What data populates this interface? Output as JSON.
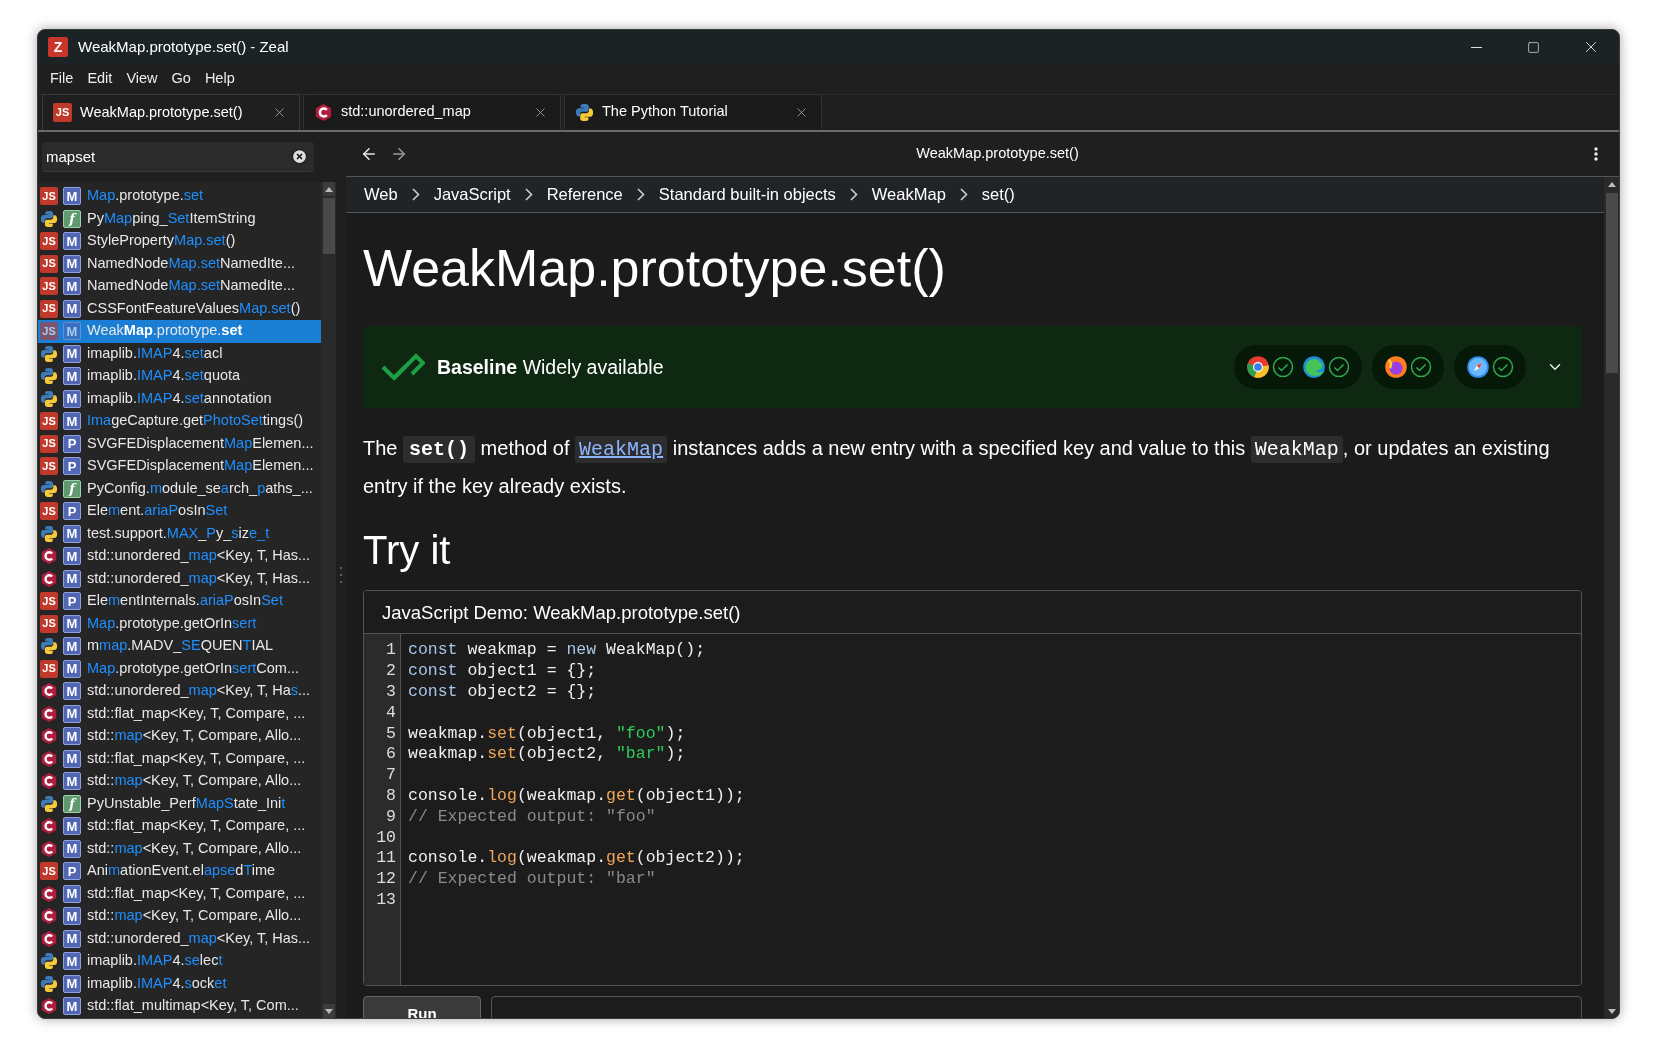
{
  "window": {
    "title": "WeakMap.prototype.set() - Zeal",
    "icon_letter": "Z"
  },
  "menu": [
    "File",
    "Edit",
    "View",
    "Go",
    "Help"
  ],
  "tabs": [
    {
      "kind": "js",
      "badge": "JS",
      "label": "WeakMap.prototype.set()",
      "selected": true
    },
    {
      "kind": "cpp",
      "label": "std::unordered_map",
      "selected": false
    },
    {
      "kind": "python",
      "label": "The Python Tutorial",
      "selected": false
    }
  ],
  "search": {
    "value": "mapset"
  },
  "results": [
    {
      "kind": "js",
      "badge": "JS",
      "type": "M",
      "selected": false,
      "parts": [
        {
          "text": "Map",
          "match": true
        },
        {
          "text": ".prototype.",
          "match": false
        },
        {
          "text": "set",
          "match": true
        }
      ]
    },
    {
      "kind": "python",
      "type": "f",
      "selected": false,
      "parts": [
        {
          "text": "Py",
          "match": false
        },
        {
          "text": "Map",
          "match": true
        },
        {
          "text": "ping_",
          "match": false
        },
        {
          "text": "Set",
          "match": true
        },
        {
          "text": "ItemString",
          "match": false
        }
      ]
    },
    {
      "kind": "js",
      "badge": "JS",
      "type": "M",
      "selected": false,
      "parts": [
        {
          "text": "StyleProperty",
          "match": false
        },
        {
          "text": "Map.set",
          "match": true
        },
        {
          "text": "()",
          "match": false
        }
      ]
    },
    {
      "kind": "js",
      "badge": "JS",
      "type": "M",
      "selected": false,
      "parts": [
        {
          "text": "NamedNode",
          "match": false
        },
        {
          "text": "Map.set",
          "match": true
        },
        {
          "text": "NamedIte...",
          "match": false
        }
      ]
    },
    {
      "kind": "js",
      "badge": "JS",
      "type": "M",
      "selected": false,
      "parts": [
        {
          "text": "NamedNode",
          "match": false
        },
        {
          "text": "Map.set",
          "match": true
        },
        {
          "text": "NamedIte...",
          "match": false
        }
      ]
    },
    {
      "kind": "js",
      "badge": "JS",
      "type": "M",
      "selected": false,
      "parts": [
        {
          "text": "CSSFontFeatureValues",
          "match": false
        },
        {
          "text": "Map.set",
          "match": true
        },
        {
          "text": "()",
          "match": false
        }
      ]
    },
    {
      "kind": "js",
      "badge": "JS",
      "type": "M",
      "selected": true,
      "parts": [
        {
          "text": "Weak",
          "match": false
        },
        {
          "text": "Map",
          "match": true
        },
        {
          "text": ".prototype.",
          "match": false
        },
        {
          "text": "set",
          "match": true
        }
      ]
    },
    {
      "kind": "python",
      "type": "M",
      "selected": false,
      "parts": [
        {
          "text": "imaplib.",
          "match": false
        },
        {
          "text": "IMAP",
          "match": true
        },
        {
          "text": "4.",
          "match": false
        },
        {
          "text": "set",
          "match": true
        },
        {
          "text": "acl",
          "match": false
        }
      ]
    },
    {
      "kind": "python",
      "type": "M",
      "selected": false,
      "parts": [
        {
          "text": "imaplib.",
          "match": false
        },
        {
          "text": "IMAP",
          "match": true
        },
        {
          "text": "4.",
          "match": false
        },
        {
          "text": "set",
          "match": true
        },
        {
          "text": "quota",
          "match": false
        }
      ]
    },
    {
      "kind": "python",
      "type": "M",
      "selected": false,
      "parts": [
        {
          "text": "imaplib.",
          "match": false
        },
        {
          "text": "IMAP",
          "match": true
        },
        {
          "text": "4.",
          "match": false
        },
        {
          "text": "set",
          "match": true
        },
        {
          "text": "annotation",
          "match": false
        }
      ]
    },
    {
      "kind": "js",
      "badge": "JS",
      "type": "M",
      "selected": false,
      "parts": [
        {
          "text": "Ima",
          "match": true
        },
        {
          "text": "geCapture.get",
          "match": false
        },
        {
          "text": "PhotoSet",
          "match": true
        },
        {
          "text": "tings()",
          "match": false
        }
      ]
    },
    {
      "kind": "js",
      "badge": "JS",
      "type": "P",
      "selected": false,
      "parts": [
        {
          "text": "SVGFEDisplacement",
          "match": false
        },
        {
          "text": "Map",
          "match": true
        },
        {
          "text": "Elemen...",
          "match": false
        }
      ]
    },
    {
      "kind": "js",
      "badge": "JS",
      "type": "P",
      "selected": false,
      "parts": [
        {
          "text": "SVGFEDisplacement",
          "match": false
        },
        {
          "text": "Map",
          "match": true
        },
        {
          "text": "Elemen...",
          "match": false
        }
      ]
    },
    {
      "kind": "python",
      "type": "f",
      "selected": false,
      "parts": [
        {
          "text": "PyConfig.",
          "match": false
        },
        {
          "text": "m",
          "match": true
        },
        {
          "text": "odule_se",
          "match": false
        },
        {
          "text": "a",
          "match": true
        },
        {
          "text": "rch_",
          "match": false
        },
        {
          "text": "p",
          "match": true
        },
        {
          "text": "aths_...",
          "match": false
        }
      ]
    },
    {
      "kind": "js",
      "badge": "JS",
      "type": "P",
      "selected": false,
      "parts": [
        {
          "text": "Ele",
          "match": false
        },
        {
          "text": "m",
          "match": true
        },
        {
          "text": "ent.",
          "match": false
        },
        {
          "text": "ariaP",
          "match": true
        },
        {
          "text": "osIn",
          "match": false
        },
        {
          "text": "Set",
          "match": true
        }
      ]
    },
    {
      "kind": "python",
      "type": "M",
      "selected": false,
      "parts": [
        {
          "text": "test.support.",
          "match": false
        },
        {
          "text": "MAX",
          "match": true
        },
        {
          "text": "_",
          "match": false
        },
        {
          "text": "P",
          "match": true
        },
        {
          "text": "y_",
          "match": false
        },
        {
          "text": "s",
          "match": true
        },
        {
          "text": "iz",
          "match": false
        },
        {
          "text": "e_t",
          "match": true
        }
      ]
    },
    {
      "kind": "cpp",
      "type": "M",
      "selected": false,
      "parts": [
        {
          "text": "std::unordered_",
          "match": false
        },
        {
          "text": "map",
          "match": true
        },
        {
          "text": "<Key, T, Has...",
          "match": false
        }
      ]
    },
    {
      "kind": "cpp",
      "type": "M",
      "selected": false,
      "parts": [
        {
          "text": "std::unordered_",
          "match": false
        },
        {
          "text": "map",
          "match": true
        },
        {
          "text": "<Key, T, Has...",
          "match": false
        }
      ]
    },
    {
      "kind": "js",
      "badge": "JS",
      "type": "P",
      "selected": false,
      "parts": [
        {
          "text": "Ele",
          "match": false
        },
        {
          "text": "m",
          "match": true
        },
        {
          "text": "entInternals.",
          "match": false
        },
        {
          "text": "ariaP",
          "match": true
        },
        {
          "text": "osIn",
          "match": false
        },
        {
          "text": "Set",
          "match": true
        }
      ]
    },
    {
      "kind": "js",
      "badge": "JS",
      "type": "M",
      "selected": false,
      "parts": [
        {
          "text": "Map",
          "match": true
        },
        {
          "text": ".prototype.getOrIn",
          "match": false
        },
        {
          "text": "sert",
          "match": true
        }
      ]
    },
    {
      "kind": "python",
      "type": "M",
      "selected": false,
      "parts": [
        {
          "text": "m",
          "match": false
        },
        {
          "text": "map",
          "match": true
        },
        {
          "text": ".MADV_",
          "match": false
        },
        {
          "text": "SE",
          "match": true
        },
        {
          "text": "QUEN",
          "match": false
        },
        {
          "text": "T",
          "match": true
        },
        {
          "text": "IAL",
          "match": false
        }
      ]
    },
    {
      "kind": "js",
      "badge": "JS",
      "type": "M",
      "selected": false,
      "parts": [
        {
          "text": "Map",
          "match": true
        },
        {
          "text": ".prototype.getOrIn",
          "match": false
        },
        {
          "text": "sert",
          "match": true
        },
        {
          "text": "Com...",
          "match": false
        }
      ]
    },
    {
      "kind": "cpp",
      "type": "M",
      "selected": false,
      "parts": [
        {
          "text": "std::unordered_",
          "match": false
        },
        {
          "text": "map",
          "match": true
        },
        {
          "text": "<Key, T, Ha",
          "match": false
        },
        {
          "text": "s",
          "match": true
        },
        {
          "text": "...",
          "match": false
        }
      ]
    },
    {
      "kind": "cpp",
      "type": "M",
      "selected": false,
      "parts": [
        {
          "text": "std::flat_map<Key, T, Compare, ...",
          "match": false
        }
      ]
    },
    {
      "kind": "cpp",
      "type": "M",
      "selected": false,
      "parts": [
        {
          "text": "std::",
          "match": false
        },
        {
          "text": "map",
          "match": true
        },
        {
          "text": "<Key, T, Compare, Allo...",
          "match": false
        }
      ]
    },
    {
      "kind": "cpp",
      "type": "M",
      "selected": false,
      "parts": [
        {
          "text": "std::flat_map<Key, T, Compare, ...",
          "match": false
        }
      ]
    },
    {
      "kind": "cpp",
      "type": "M",
      "selected": false,
      "parts": [
        {
          "text": "std::",
          "match": false
        },
        {
          "text": "map",
          "match": true
        },
        {
          "text": "<Key, T, Compare, Allo...",
          "match": false
        }
      ]
    },
    {
      "kind": "python",
      "type": "f",
      "selected": false,
      "parts": [
        {
          "text": "PyUnstable_Perf",
          "match": false
        },
        {
          "text": "MapS",
          "match": true
        },
        {
          "text": "tate_Ini",
          "match": false
        },
        {
          "text": "t",
          "match": true
        }
      ]
    },
    {
      "kind": "cpp",
      "type": "M",
      "selected": false,
      "parts": [
        {
          "text": "std::flat_map<Key, T, Compare, ...",
          "match": false
        }
      ]
    },
    {
      "kind": "cpp",
      "type": "M",
      "selected": false,
      "parts": [
        {
          "text": "std::",
          "match": false
        },
        {
          "text": "map",
          "match": true
        },
        {
          "text": "<Key, T, Compare, Allo...",
          "match": false
        }
      ]
    },
    {
      "kind": "js",
      "badge": "JS",
      "type": "P",
      "selected": false,
      "parts": [
        {
          "text": "Ani",
          "match": false
        },
        {
          "text": "m",
          "match": true
        },
        {
          "text": "ationEvent.el",
          "match": false
        },
        {
          "text": "apse",
          "match": true
        },
        {
          "text": "d",
          "match": false
        },
        {
          "text": "T",
          "match": true
        },
        {
          "text": "ime",
          "match": false
        }
      ]
    },
    {
      "kind": "cpp",
      "type": "M",
      "selected": false,
      "parts": [
        {
          "text": "std::flat_map<Key, T, Compare, ...",
          "match": false
        }
      ]
    },
    {
      "kind": "cpp",
      "type": "M",
      "selected": false,
      "parts": [
        {
          "text": "std::",
          "match": false
        },
        {
          "text": "map",
          "match": true
        },
        {
          "text": "<Key, T, Compare, Allo...",
          "match": false
        }
      ]
    },
    {
      "kind": "cpp",
      "type": "M",
      "selected": false,
      "parts": [
        {
          "text": "std::unordered_",
          "match": false
        },
        {
          "text": "map",
          "match": true
        },
        {
          "text": "<Key, T, Has...",
          "match": false
        }
      ]
    },
    {
      "kind": "python",
      "type": "M",
      "selected": false,
      "parts": [
        {
          "text": "imaplib.",
          "match": false
        },
        {
          "text": "IMAP",
          "match": true
        },
        {
          "text": "4.",
          "match": false
        },
        {
          "text": "se",
          "match": true
        },
        {
          "text": "lec",
          "match": false
        },
        {
          "text": "t",
          "match": true
        }
      ]
    },
    {
      "kind": "python",
      "type": "M",
      "selected": false,
      "parts": [
        {
          "text": "imaplib.",
          "match": false
        },
        {
          "text": "IMAP",
          "match": true
        },
        {
          "text": "4.",
          "match": false
        },
        {
          "text": "s",
          "match": true
        },
        {
          "text": "ock",
          "match": false
        },
        {
          "text": "et",
          "match": true
        }
      ]
    },
    {
      "kind": "cpp",
      "type": "M",
      "selected": false,
      "parts": [
        {
          "text": "std::flat_multimap<Key, T, Com...",
          "match": false
        }
      ]
    }
  ],
  "page_title": "WeakMap.prototype.set()",
  "breadcrumbs": [
    "Web",
    "JavaScript",
    "Reference",
    "Standard built-in objects",
    "WeakMap",
    "set()"
  ],
  "heading": "WeakMap.prototype.set()",
  "baseline": {
    "label": "**Baseline** Widely available",
    "browser_groups": [
      [
        {
          "kind": "chrome"
        },
        {
          "kind": "edge"
        }
      ],
      [
        {
          "kind": "firefox"
        }
      ],
      [
        {
          "kind": "safari"
        }
      ]
    ]
  },
  "intro": [
    {
      "kind": "text",
      "t": "The "
    },
    {
      "kind": "code_bold",
      "t": "set()"
    },
    {
      "kind": "text",
      "t": " method of "
    },
    {
      "kind": "link",
      "t": "WeakMap"
    },
    {
      "kind": "text",
      "t": " instances adds a new entry with a specified key and value to this "
    },
    {
      "kind": "code",
      "t": "WeakMap"
    },
    {
      "kind": "text",
      "t": ", or updates an existing entry if the key already exists."
    }
  ],
  "try_it": {
    "heading": "Try it",
    "demo_title": "JavaScript Demo: WeakMap.prototype.set()",
    "lines": [
      {
        "number": "1",
        "tokens": [
          {
            "kind": "kw",
            "text": "const"
          },
          {
            "kind": "plain",
            "text": " weakmap = "
          },
          {
            "kind": "kw",
            "text": "new"
          },
          {
            "kind": "plain",
            "text": " WeakMap();"
          }
        ]
      },
      {
        "number": "2",
        "tokens": [
          {
            "kind": "kw",
            "text": "const"
          },
          {
            "kind": "plain",
            "text": " object1 = {};"
          }
        ]
      },
      {
        "number": "3",
        "tokens": [
          {
            "kind": "kw",
            "text": "const"
          },
          {
            "kind": "plain",
            "text": " object2 = {};"
          }
        ]
      },
      {
        "number": "4"
      },
      {
        "number": "5",
        "tokens": [
          {
            "kind": "plain",
            "text": "weakmap."
          },
          {
            "kind": "fn",
            "text": "set"
          },
          {
            "kind": "plain",
            "text": "(object1, "
          },
          {
            "kind": "str",
            "text": "\"foo\""
          },
          {
            "kind": "plain",
            "text": ");"
          }
        ]
      },
      {
        "number": "6",
        "tokens": [
          {
            "kind": "plain",
            "text": "weakmap."
          },
          {
            "kind": "fn",
            "text": "set"
          },
          {
            "kind": "plain",
            "text": "(object2, "
          },
          {
            "kind": "str",
            "text": "\"bar\""
          },
          {
            "kind": "plain",
            "text": ");"
          }
        ]
      },
      {
        "number": "7"
      },
      {
        "number": "8",
        "tokens": [
          {
            "kind": "plain",
            "text": "console."
          },
          {
            "kind": "fn",
            "text": "log"
          },
          {
            "kind": "plain",
            "text": "(weakmap."
          },
          {
            "kind": "fn",
            "text": "get"
          },
          {
            "kind": "plain",
            "text": "(object1));"
          }
        ]
      },
      {
        "number": "9",
        "tokens": [
          {
            "kind": "cmt",
            "text": "// Expected output: \"foo\""
          }
        ]
      },
      {
        "number": "10"
      },
      {
        "number": "11",
        "tokens": [
          {
            "kind": "plain",
            "text": "console."
          },
          {
            "kind": "fn",
            "text": "log"
          },
          {
            "kind": "plain",
            "text": "(weakmap."
          },
          {
            "kind": "fn",
            "text": "get"
          },
          {
            "kind": "plain",
            "text": "(object2));"
          }
        ]
      },
      {
        "number": "12",
        "tokens": [
          {
            "kind": "cmt",
            "text": "// Expected output: \"bar\""
          }
        ]
      },
      {
        "number": "13"
      }
    ],
    "run_button": "Run"
  }
}
